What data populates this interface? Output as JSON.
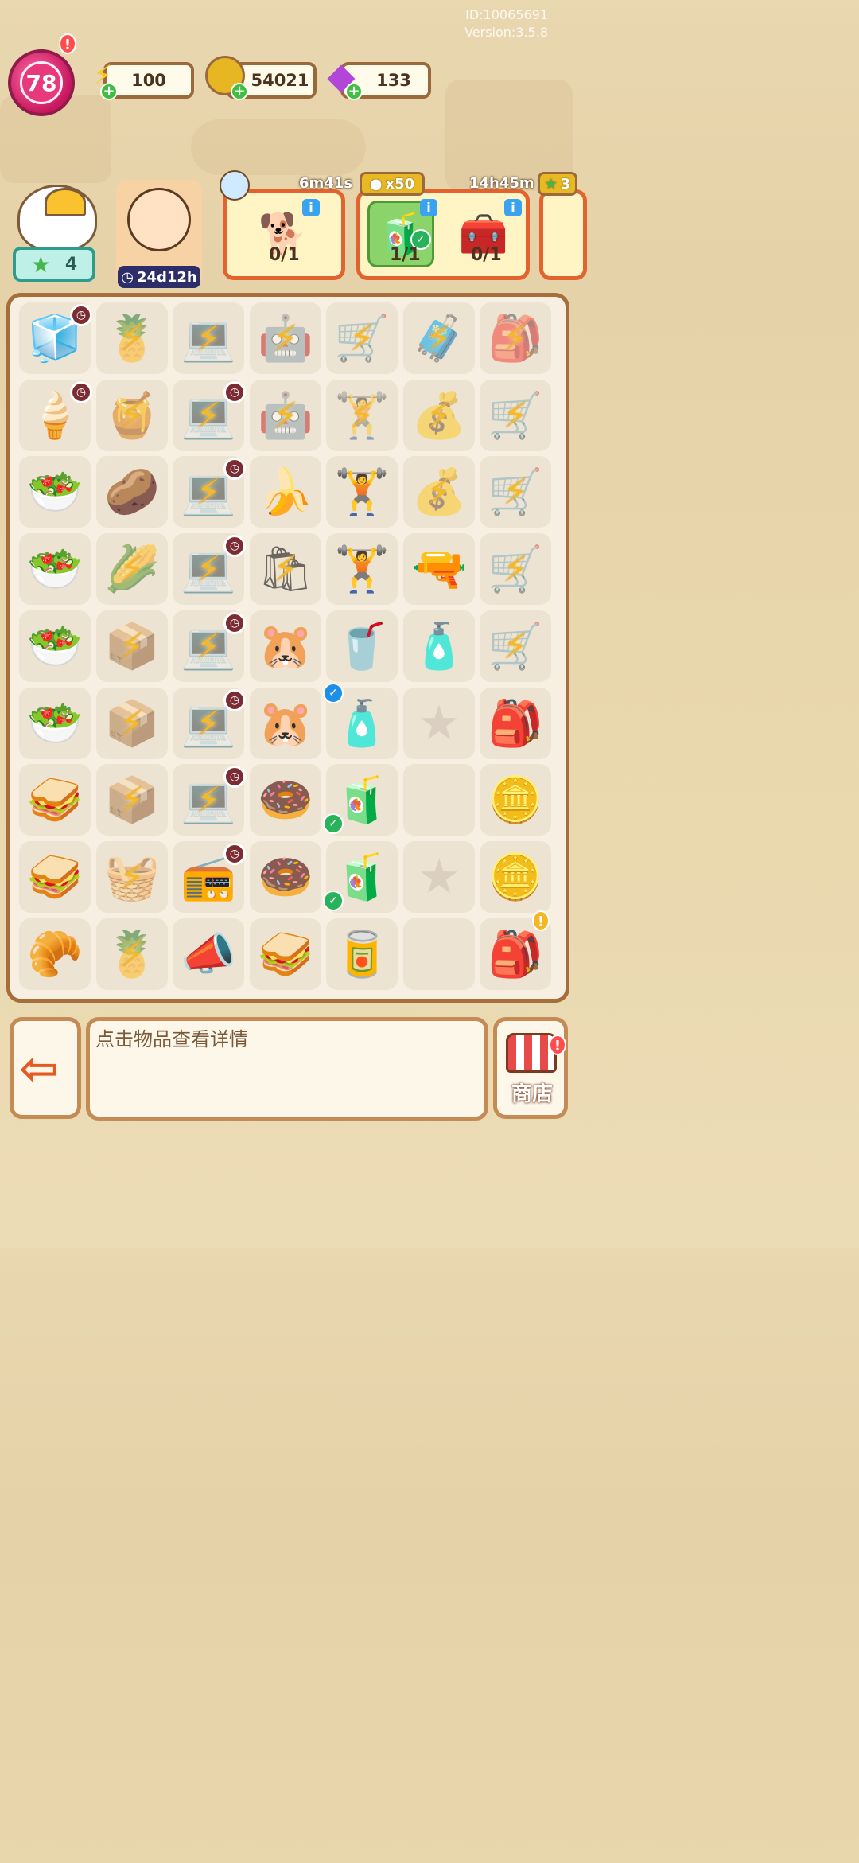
{
  "meta": {
    "id_text": "ID:10065691",
    "version_text": "Version:3.5.8"
  },
  "player": {
    "level": "78",
    "alert": "!"
  },
  "resources": [
    {
      "name": "energy",
      "value": "100",
      "icon": "⚡",
      "color": "#f6c928"
    },
    {
      "name": "coins",
      "value": "54021",
      "icon": "●",
      "color": "#e6b623"
    },
    {
      "name": "gems",
      "value": "133",
      "icon": "◆",
      "color": "#b146d8"
    }
  ],
  "helper": {
    "stars": "4"
  },
  "character": {
    "timer": "24d12h"
  },
  "orders": [
    {
      "name": "order-dog",
      "timer": "6m41s",
      "progress": "0/1",
      "item_icon": "🐕",
      "done": false
    },
    {
      "name": "order-drink-box",
      "reward": "x50",
      "timer": "14h45m",
      "items": [
        {
          "icon": "🧃",
          "progress": "1/1",
          "done": true
        },
        {
          "icon": "🧰",
          "progress": "0/1",
          "done": false
        }
      ]
    },
    {
      "name": "order-partial",
      "reward_stars": "3"
    }
  ],
  "board": {
    "rows": [
      [
        {
          "i": "🧊",
          "clock": true
        },
        {
          "i": "🍍",
          "lock": true
        },
        {
          "i": "💻",
          "lock": true
        },
        {
          "i": "🤖",
          "lock": true
        },
        {
          "i": "🛒",
          "lock": true
        },
        {
          "i": "🧳",
          "lock": true
        },
        {
          "i": "🎒",
          "lock": true
        }
      ],
      [
        {
          "i": "🍦",
          "clock": true
        },
        {
          "i": "🍯",
          "lock": true
        },
        {
          "i": "💻",
          "lock": true,
          "clock": true
        },
        {
          "i": "🤖",
          "lock": true
        },
        {
          "i": "🏋",
          "lock": true
        },
        {
          "i": "💰",
          "lock": true
        },
        {
          "i": "🛒",
          "lock": true
        }
      ],
      [
        {
          "i": "🥗"
        },
        {
          "i": "🥔"
        },
        {
          "i": "💻",
          "lock": true,
          "clock": true
        },
        {
          "i": "🍌"
        },
        {
          "i": "🏋"
        },
        {
          "i": "💰",
          "lock": true
        },
        {
          "i": "🛒",
          "lock": true
        }
      ],
      [
        {
          "i": "🥗"
        },
        {
          "i": "🌽",
          "lock": true
        },
        {
          "i": "💻",
          "lock": true,
          "clock": true
        },
        {
          "i": "🛍",
          "lock": true
        },
        {
          "i": "🏋"
        },
        {
          "i": "🔫"
        },
        {
          "i": "🛒",
          "lock": true
        }
      ],
      [
        {
          "i": "🥗"
        },
        {
          "i": "📦",
          "lock": true
        },
        {
          "i": "💻",
          "lock": true,
          "clock": true
        },
        {
          "i": "🐹"
        },
        {
          "i": "🥤"
        },
        {
          "i": "🧴"
        },
        {
          "i": "🛒",
          "lock": true
        }
      ],
      [
        {
          "i": "🥗"
        },
        {
          "i": "📦",
          "lock": true
        },
        {
          "i": "💻",
          "lock": true,
          "clock": true
        },
        {
          "i": "🐹"
        },
        {
          "i": "🧴",
          "check": "blue"
        },
        {
          "empty_star": true
        },
        {
          "i": "🎒"
        }
      ],
      [
        {
          "i": "🥪"
        },
        {
          "i": "📦",
          "lock": true
        },
        {
          "i": "💻",
          "lock": true,
          "clock": true
        },
        {
          "i": "🍩"
        },
        {
          "i": "🧃",
          "check": "green"
        },
        {
          "empty": true
        },
        {
          "i": "🪙"
        }
      ],
      [
        {
          "i": "🥪"
        },
        {
          "i": "🧺",
          "lock": true
        },
        {
          "i": "📻",
          "clock": true
        },
        {
          "i": "🍩"
        },
        {
          "i": "🧃",
          "check": "green"
        },
        {
          "empty_star": true
        },
        {
          "i": "🪙"
        }
      ],
      [
        {
          "i": "🥐"
        },
        {
          "i": "🍍",
          "lock": true
        },
        {
          "i": "📣"
        },
        {
          "i": "🥪"
        },
        {
          "i": "🥫"
        },
        {
          "empty": true
        },
        {
          "i": "🎒",
          "alert": true
        }
      ]
    ]
  },
  "bottom": {
    "info_text": "点击物品查看详情",
    "shop_label": "商店",
    "shop_alert": "!"
  }
}
